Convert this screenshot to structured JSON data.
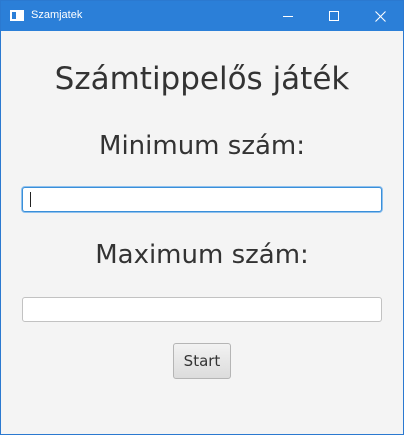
{
  "window": {
    "title": "Szamjatek",
    "controls": {
      "minimize_icon": "minimize-icon",
      "maximize_icon": "maximize-icon",
      "close_icon": "close-icon"
    },
    "accent_color": "#2b7fd8"
  },
  "main": {
    "title": "Számtippelős játék",
    "min_label": "Minimum szám:",
    "min_value": "",
    "max_label": "Maximum szám:",
    "max_value": "",
    "start_label": "Start"
  }
}
